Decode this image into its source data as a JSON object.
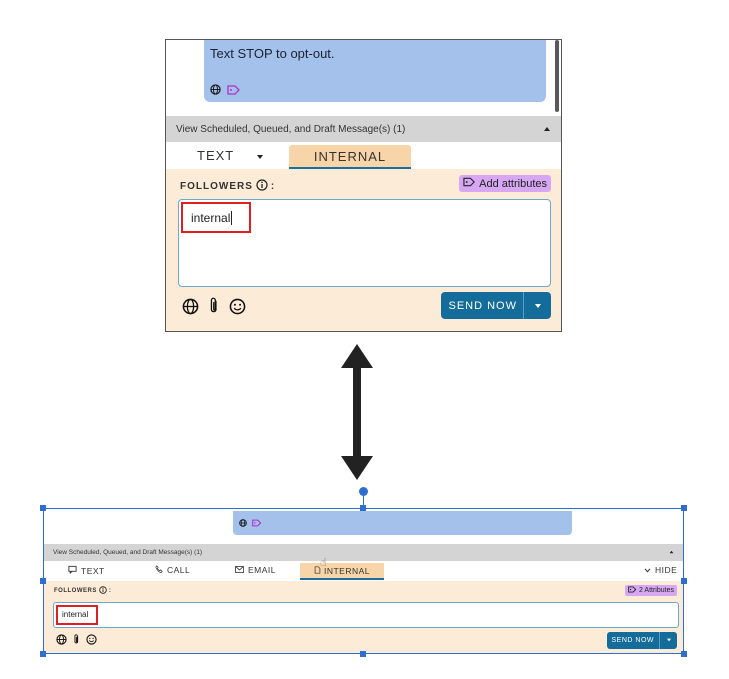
{
  "top": {
    "message_text": "Text STOP to opt-out.",
    "scheduled_label": "View Scheduled, Queued, and Draft Message(s) (1)",
    "tab_text": "TEXT",
    "tab_internal": "INTERNAL",
    "followers_label": "FOLLOWERS",
    "followers_suffix": ":",
    "attributes_label": "Add attributes",
    "typed_text": "internal",
    "send_label": "SEND NOW"
  },
  "bottom": {
    "scheduled_label": "View Scheduled, Queued, and Draft Message(s) (1)",
    "tabs": {
      "text": "TEXT",
      "call": "CALL",
      "email": "EMAIL",
      "internal": "INTERNAL",
      "hide": "HIDE"
    },
    "followers_label": "FOLLOWERS",
    "followers_suffix": ":",
    "attributes_label": "2 Attributes",
    "typed_text": "internal",
    "send_label": "SEND NOW"
  },
  "colors": {
    "message_bubble": "#a4c1ec",
    "internal_tab": "#f8d5a8",
    "compose_bg": "#fcebd6",
    "attribute_badge": "#d7a7f4",
    "send_button": "#146c9a",
    "highlight_box": "#e02020",
    "selection": "#2f6ed0"
  }
}
